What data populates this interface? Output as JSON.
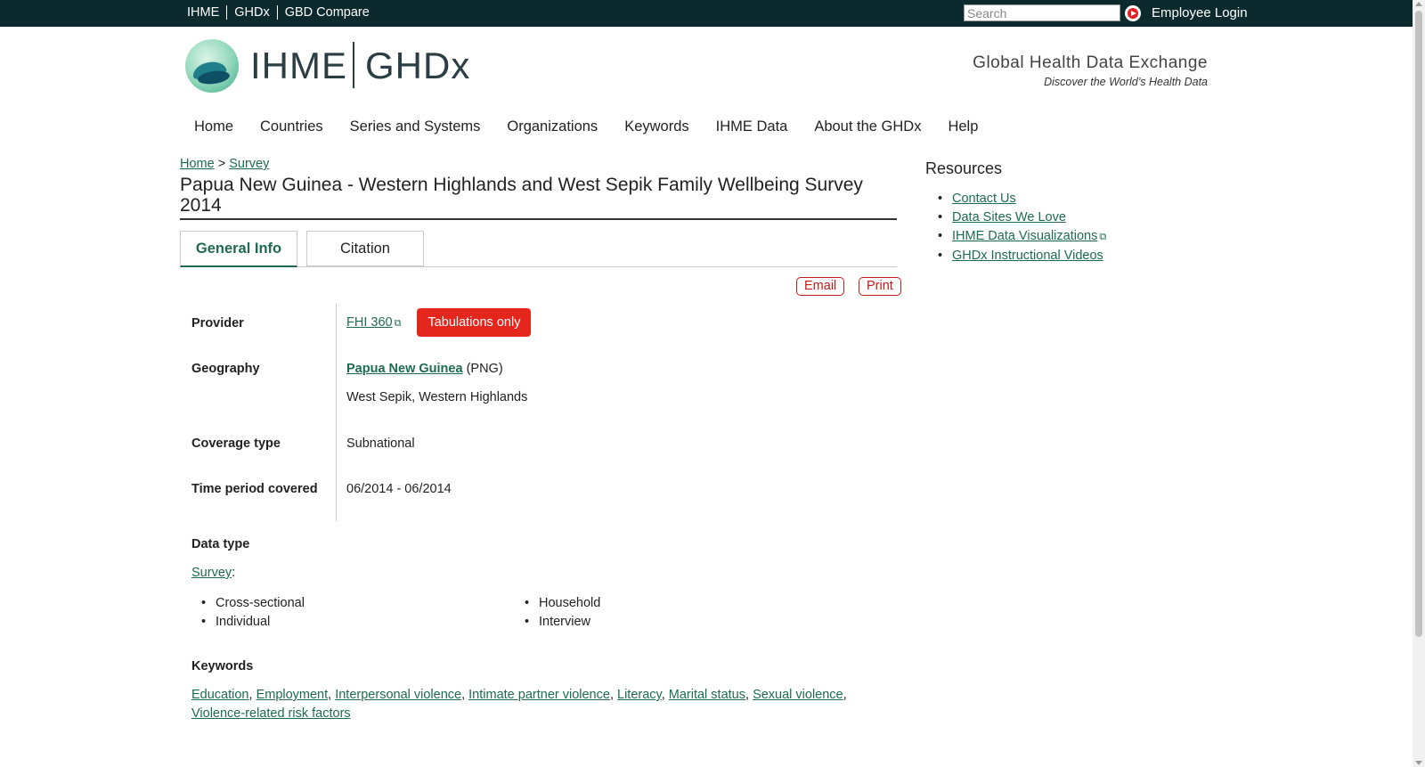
{
  "topbar": {
    "links": [
      "IHME",
      "GHDx",
      "GBD Compare"
    ],
    "search_placeholder": "Search",
    "employee_login": "Employee Login"
  },
  "header": {
    "logo_ihme": "IHME",
    "logo_ghdx": "GHDx",
    "tagline_title": "Global Health Data Exchange",
    "tagline_sub": "Discover the World’s Health Data"
  },
  "nav": [
    "Home",
    "Countries",
    "Series and Systems",
    "Organizations",
    "Keywords",
    "IHME Data",
    "About the GHDx",
    "Help"
  ],
  "breadcrumb": {
    "home": "Home",
    "separator": ">",
    "current": "Survey"
  },
  "page_title": "Papua New Guinea - Western Highlands and West Sepik Family Wellbeing Survey 2014",
  "tabs": {
    "general": "General Info",
    "citation": "Citation"
  },
  "actions": {
    "email": "Email",
    "print": "Print"
  },
  "fields": {
    "provider_label": "Provider",
    "provider_value": "FHI 360",
    "provider_badge": "Tabulations only",
    "geography_label": "Geography",
    "geography_country": "Papua New Guinea",
    "geography_code": "(PNG)",
    "geography_sub": "West Sepik, Western Highlands",
    "coverage_label": "Coverage type",
    "coverage_value": "Subnational",
    "time_label": "Time period covered",
    "time_value": "06/2014 - 06/2014"
  },
  "data_type": {
    "label": "Data type",
    "link": "Survey",
    "col1": [
      "Cross-sectional",
      "Individual"
    ],
    "col2": [
      "Household",
      "Interview"
    ]
  },
  "keywords": {
    "label": "Keywords",
    "items": [
      "Education",
      "Employment",
      "Interpersonal violence",
      "Intimate partner violence",
      "Literacy",
      "Marital status",
      "Sexual violence",
      "Violence-related risk factors"
    ]
  },
  "sidebar": {
    "title": "Resources",
    "items": [
      "Contact Us",
      "Data Sites We Love",
      "IHME Data Visualizations",
      "GHDx Instructional Videos"
    ]
  },
  "colors": {
    "accent_green": "#1e6b52",
    "badge_red": "#e5261d",
    "topbar_bg": "#0c2a2e"
  }
}
